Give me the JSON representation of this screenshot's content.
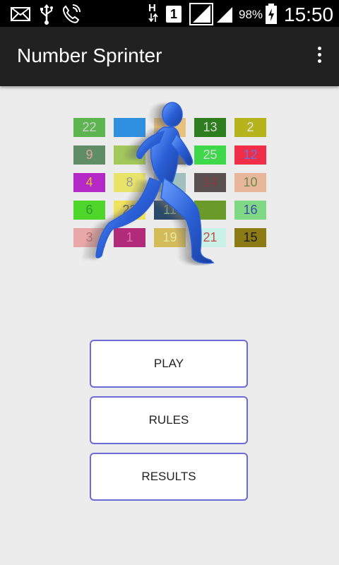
{
  "status_bar": {
    "icons": [
      "mail-icon",
      "usb-icon",
      "wifi-call-icon",
      "hspa-icon",
      "sim-1-icon",
      "signal-icon",
      "signal-icon",
      "battery-charging-icon"
    ],
    "network_type": "H",
    "sim_label": "1",
    "battery_percent": "98%",
    "time": "15:50"
  },
  "app_bar": {
    "title": "Number Sprinter",
    "overflow_icon": "more-vert-icon"
  },
  "logo": {
    "tiles": [
      {
        "n": "22",
        "bg": "#5cb54f",
        "fg": "#d0d0d0"
      },
      {
        "n": "",
        "bg": "#2f8fe0",
        "fg": "#ffffff"
      },
      {
        "n": "",
        "bg": "#e9c07c",
        "fg": "#ffffff"
      },
      {
        "n": "13",
        "bg": "#2e7d1e",
        "fg": "#d9d9d9"
      },
      {
        "n": "2",
        "bg": "#b5b41c",
        "fg": "#e5e5e5"
      },
      {
        "n": "9",
        "bg": "#5f8e66",
        "fg": "#e6a2a2"
      },
      {
        "n": "",
        "bg": "#a3c95b",
        "fg": "#ffffff"
      },
      {
        "n": "",
        "bg": "#6f6f6f",
        "fg": "#ffffff"
      },
      {
        "n": "25",
        "bg": "#3fd84a",
        "fg": "#d8d8d8"
      },
      {
        "n": "12",
        "bg": "#f02e48",
        "fg": "#6f6fe0"
      },
      {
        "n": "4",
        "bg": "#b429c6",
        "fg": "#e8c030"
      },
      {
        "n": "8",
        "bg": "#e8e46a",
        "fg": "#9a9a9a"
      },
      {
        "n": "",
        "bg": "#a0c0c0",
        "fg": "#ffffff"
      },
      {
        "n": "14",
        "bg": "#5a5050",
        "fg": "#8b3a3a"
      },
      {
        "n": "10",
        "bg": "#e8b69a",
        "fg": "#6c8a4a"
      },
      {
        "n": "6",
        "bg": "#4fd62a",
        "fg": "#2f9a2f"
      },
      {
        "n": "23",
        "bg": "#efe25c",
        "fg": "#555555"
      },
      {
        "n": "11",
        "bg": "#2b4a6b",
        "fg": "#8bbd8b"
      },
      {
        "n": "",
        "bg": "#6a9a2a",
        "fg": "#ffffff"
      },
      {
        "n": "16",
        "bg": "#7ed884",
        "fg": "#3b4aa6"
      },
      {
        "n": "3",
        "bg": "#e8a8a8",
        "fg": "#c07070"
      },
      {
        "n": "1",
        "bg": "#b22a7a",
        "fg": "#e070b0"
      },
      {
        "n": "19",
        "bg": "#d4bb5a",
        "fg": "#e8e8a8"
      },
      {
        "n": "21",
        "bg": "#c9f1e6",
        "fg": "#c05050"
      },
      {
        "n": "15",
        "bg": "#8c7b14",
        "fg": "#1a1a1a"
      }
    ],
    "runner_icon": "runner-icon",
    "runner_color": "#2a5fd6"
  },
  "menu": {
    "play_label": "PLAY",
    "rules_label": "RULES",
    "results_label": "RESULTS"
  }
}
